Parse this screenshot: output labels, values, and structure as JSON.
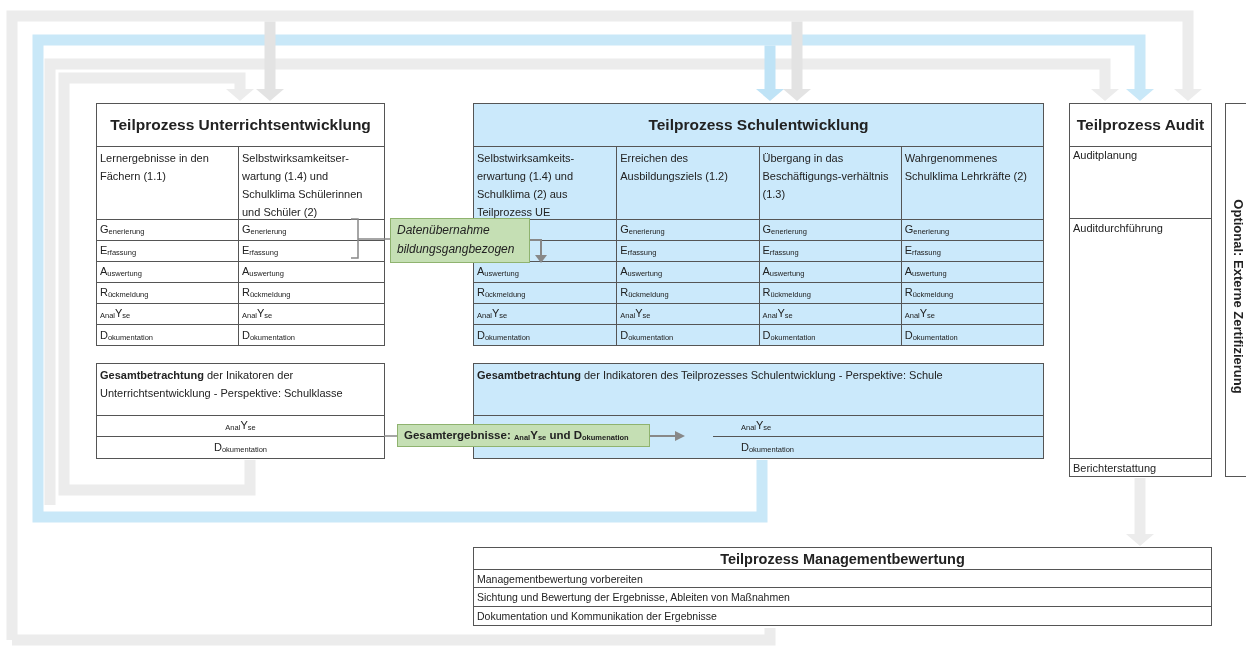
{
  "unterricht": {
    "title": "Teilprozess Unterrichtsentwicklung",
    "columns": [
      {
        "header": "Lernergebnisse in den Fächern (1.1)",
        "steps": [
          "G$_{enerierung}$",
          "E$_{rfassung}$",
          "A$_{uswertung}$",
          "R$_{ückmeldung}$",
          "$_{Anal}$Y$_{se}$",
          "D$_{okumentation}$"
        ]
      },
      {
        "header": "Selbstwirksamkeitser-wartung (1.4) und Schulklima Schülerinnen und Schüler (2)",
        "steps": [
          "G$_{enerierung}$",
          "E$_{rfassung}$",
          "A$_{uswertung}$",
          "R$_{ückmeldung}$",
          "$_{Anal}$Y$_{se}$",
          "D$_{okumentation}$"
        ]
      }
    ],
    "summary": {
      "text": "**Gesamtbetrachtung** der Inikatoren der Unterrichtsentwicklung - Perspektive: Schulklasse",
      "steps": [
        "$_{Anal}$Y$_{se}$",
        "D$_{okumentation}$"
      ]
    }
  },
  "schule": {
    "title": "Teilprozess Schulentwicklung",
    "columns": [
      {
        "header": "Selbstwirksamkeits-erwartung (1.4) und Schulklima (2) aus Teilprozess UE",
        "steps": [
          "A$_{uswertung}$",
          "R$_{ückmeldung}$",
          "$_{Anal}$Y$_{se}$",
          "D$_{okumentation}$"
        ]
      },
      {
        "header": "Erreichen des Ausbildungsziels (1.2)",
        "steps": [
          "G$_{enerierung}$",
          "E$_{rfassung}$",
          "A$_{uswertung}$",
          "R$_{ückmeldung}$",
          "$_{Anal}$Y$_{se}$",
          "D$_{okumentation}$"
        ]
      },
      {
        "header": "Übergang in das Beschäftigungs-verhältnis (1.3)",
        "steps": [
          "G$_{enerierung}$",
          "E$_{rfassung}$",
          "A$_{uswertung}$",
          "R$_{ückmeldung}$",
          "$_{Anal}$Y$_{se}$",
          "D$_{okumentation}$"
        ]
      },
      {
        "header": "Wahrgenommenes Schulklima Lehrkräfte (2)",
        "steps": [
          "G$_{enerierung}$",
          "E$_{rfassung}$",
          "A$_{uswertung}$",
          "R$_{ückmeldung}$",
          "$_{Anal}$Y$_{se}$",
          "D$_{okumentation}$"
        ]
      }
    ],
    "summary": {
      "text": "**Gesamtbetrachtung** der Indikatoren des Teilprozesses Schulentwicklung - Perspektive: Schule",
      "steps": [
        "$_{Anal}$Y$_{se}$",
        "D$_{okumentation}$"
      ]
    }
  },
  "audit": {
    "title": "Teilprozess Audit",
    "steps": [
      "Auditplanung",
      "Auditdurchführung",
      "Berichterstattung"
    ]
  },
  "optional": {
    "label": "Optional: Externe Zertifizierung"
  },
  "management": {
    "title": "Teilprozess Managementbewertung",
    "steps": [
      "Managementbewertung vorbereiten",
      "Sichtung und Bewertung der Ergebnisse, Ableiten von Maßnahmen",
      "Dokumentation und Kommunikation der Ergebnisse"
    ]
  },
  "callouts": [
    {
      "text": "Datenübernahme bildungsgangbezogen"
    },
    {
      "text": "Gesamtergebnisse: $_{Anal}$Y$_{se}$ und D$_{okumenation}$"
    }
  ]
}
